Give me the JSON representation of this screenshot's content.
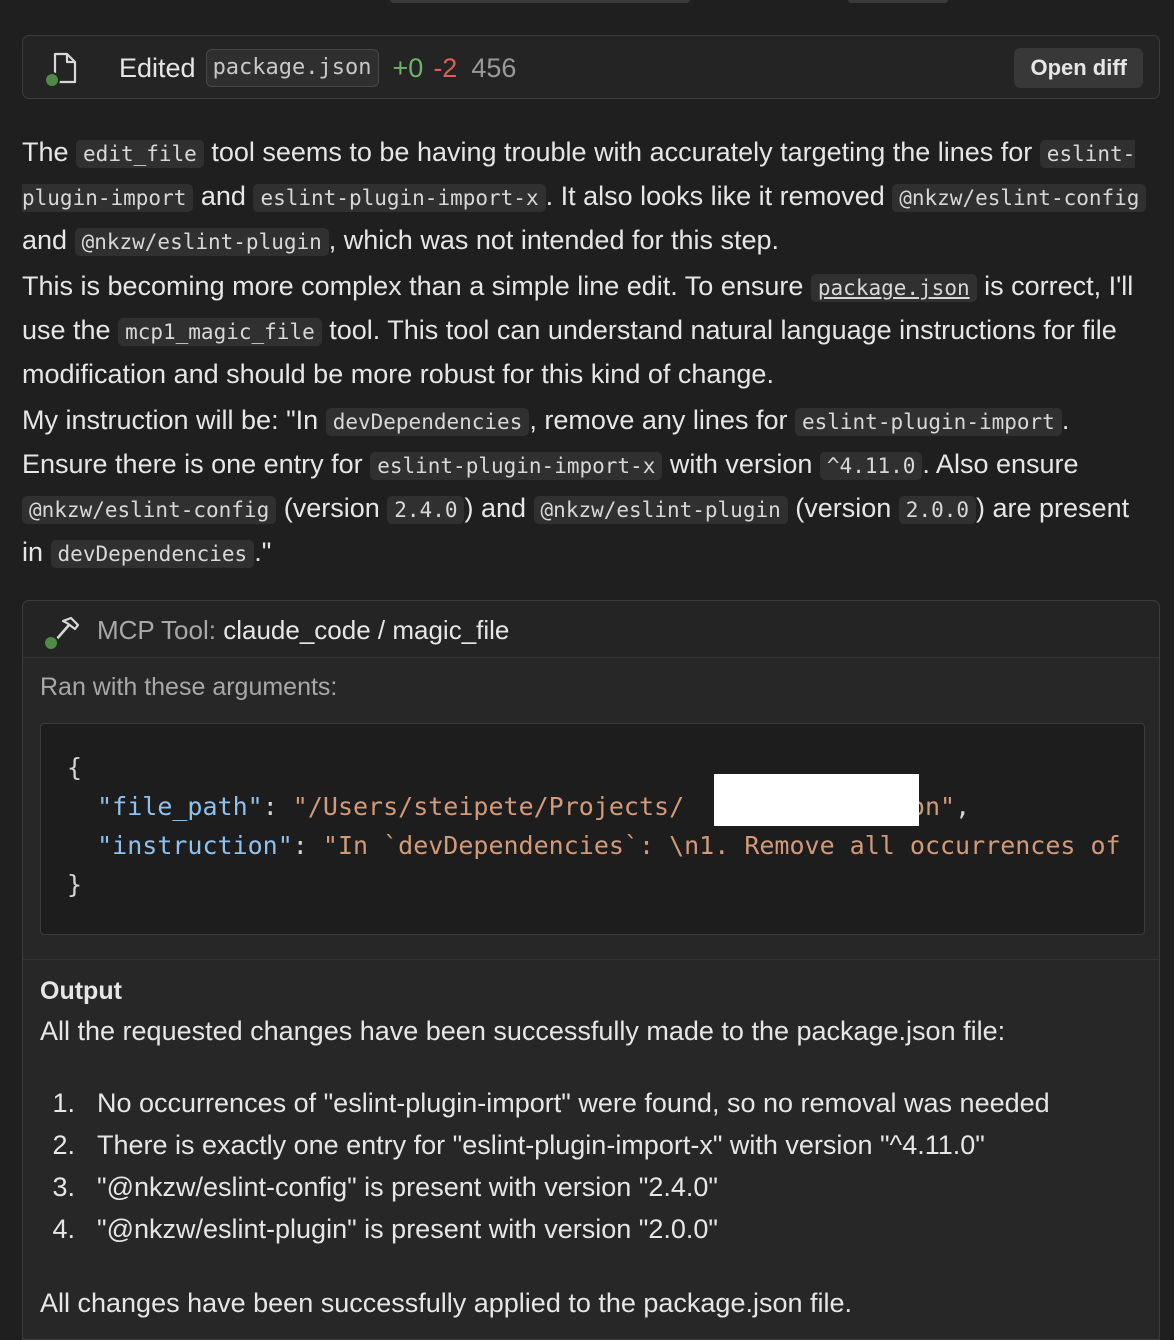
{
  "edit_card": {
    "action": "Edited",
    "filename": "package.json",
    "additions": "+0",
    "deletions": "-2",
    "count": "456",
    "open_diff_label": "Open diff"
  },
  "message": {
    "p1": {
      "t1": "The ",
      "c1": "edit_file",
      "t2": " tool seems to be having trouble with accurately targeting the lines for ",
      "c2": "eslint-plugin-import",
      "t3": " and ",
      "c3": "eslint-plugin-import-x",
      "t4": ". It also looks like it removed ",
      "c4": "@nkzw/eslint-config",
      "t5": " and ",
      "c5": "@nkzw/eslint-plugin",
      "t6": ", which was not intended for this step."
    },
    "p2": {
      "t1": "This is becoming more complex than a simple line edit. To ensure ",
      "c1": "package.json",
      "t2": " is correct, I'll use the ",
      "c2": "mcp1_magic_file",
      "t3": " tool. This tool can understand natural language instructions for file modification and should be more robust for this kind of change."
    },
    "p3": {
      "t1": "My instruction will be: \"In ",
      "c1": "devDependencies",
      "t2": ", remove any lines for ",
      "c2": "eslint-plugin-import",
      "t3": ". Ensure there is one entry for ",
      "c3": "eslint-plugin-import-x",
      "t4": " with version ",
      "c4": "^4.11.0",
      "t5": ". Also ensure ",
      "c5": "@nkzw/eslint-config",
      "t6": " (version ",
      "c6": "2.4.0",
      "t7": ") and ",
      "c7": "@nkzw/eslint-plugin",
      "t8": " (version ",
      "c8": "2.0.0",
      "t9": ") are present in ",
      "c9": "devDependencies",
      "t10": ".\""
    }
  },
  "mcp_card": {
    "title_prefix": "MCP Tool: ",
    "title": "claude_code / magic_file",
    "args_label": "Ran with these arguments:",
    "code": {
      "open_brace": "{",
      "key1": "\"file_path\"",
      "val1_start": "\"/Users/steipete/Projects/",
      "val1_end": "ackage.json\"",
      "key2": "\"instruction\"",
      "val2": "\"In `devDependencies`: \\n1. Remove all occurrences of",
      "close_brace": "}"
    },
    "output_label": "Output",
    "output_intro": "All the requested changes have been successfully made to the package.json file:",
    "output_items": [
      {
        "num": "1.",
        "text": "No occurrences of \"eslint-plugin-import\" were found, so no removal was needed"
      },
      {
        "num": "2.",
        "text": "There is exactly one entry for \"eslint-plugin-import-x\" with version \"^4.11.0\""
      },
      {
        "num": "3.",
        "text": "\"@nkzw/eslint-config\" is present with version \"2.4.0\""
      },
      {
        "num": "4.",
        "text": "\"@nkzw/eslint-plugin\" is present with version \"2.0.0\""
      }
    ],
    "output_footer": "All changes have been successfully applied to the package.json file."
  }
}
